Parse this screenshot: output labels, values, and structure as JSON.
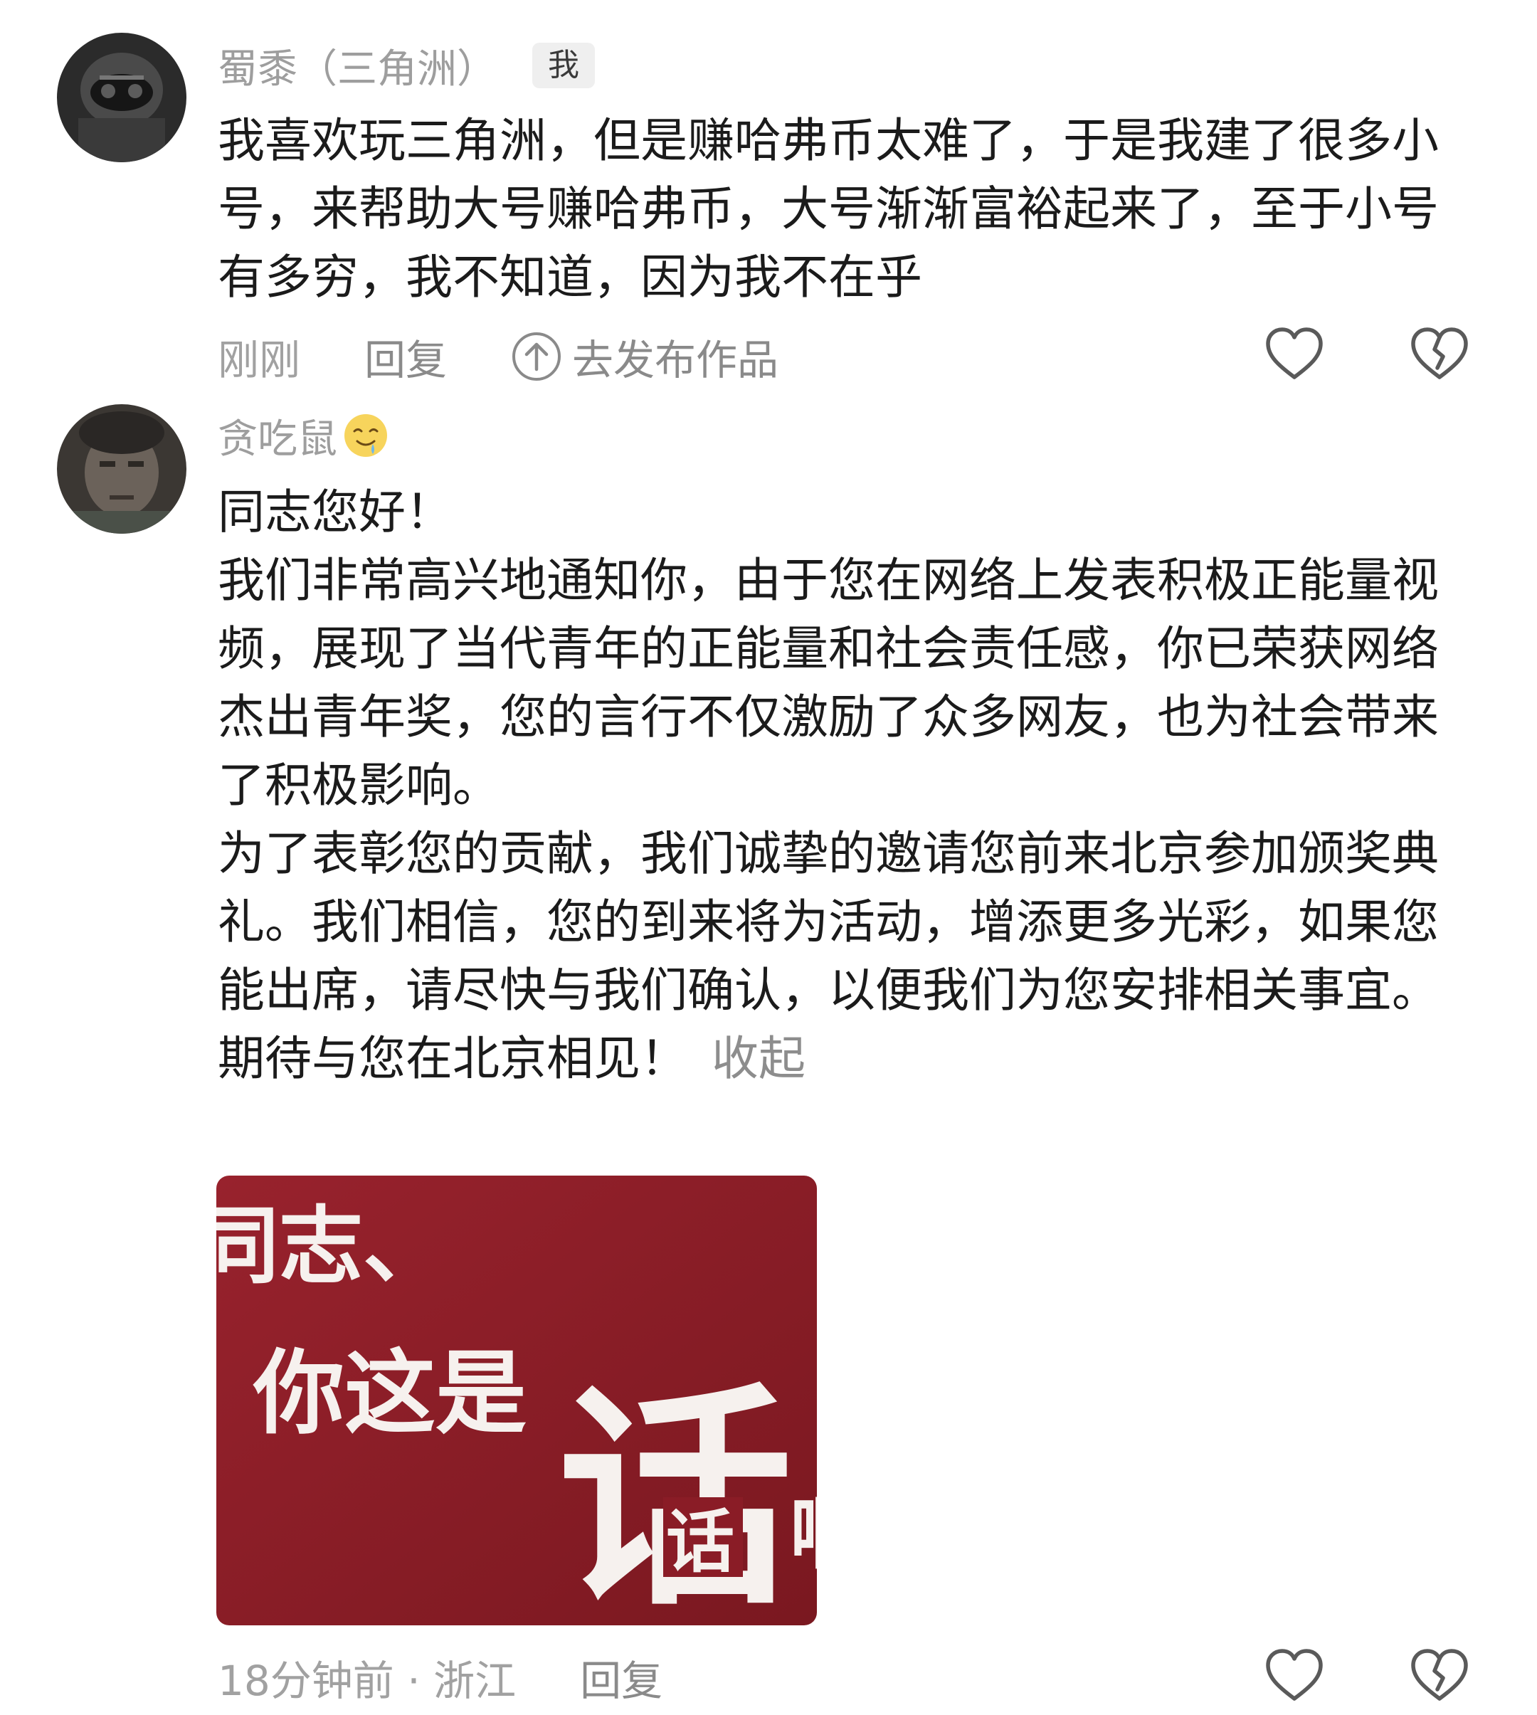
{
  "comments": [
    {
      "username": "蜀黍（三角洲）",
      "badge": "我",
      "text": "我喜欢玩三角洲，但是赚哈弗币太难了，于是我建了很多小号，来帮助大号赚哈弗币，大号渐渐富裕起来了，至于小号有多穷，我不知道，因为我不在乎",
      "time": "刚刚",
      "reply_label": "回复",
      "publish_label": "去发布作品",
      "icons": [
        "up-arrow-circle-icon",
        "heart-icon",
        "broken-heart-icon"
      ]
    },
    {
      "username": "贪吃鼠",
      "emoji": "drooling-face-emoji",
      "paragraphs": [
        "同志您好！",
        "我们非常高兴地通知你，由于您在网络上发表积极正能量视频，展现了当代青年的正能量和社会责任感，你已荣获网络杰出青年奖，您的言行不仅激励了众多网友，也为社会带来了积极影响。",
        "为了表彰您的贡献，我们诚挚的邀请您前来北京参加颁奖典礼。我们相信，您的到来将为活动，增添更多光彩，如果您能出席，请尽快与我们确认，以便我们为您安排相关事宜。",
        "期待与您在北京相见！"
      ],
      "collapse_label": "收起",
      "sticker": {
        "line1": "同志、",
        "line2": "你这是",
        "big_char": "话",
        "small_char": "话",
        "edge_char": "啊",
        "background": "#8a1c26"
      },
      "time": "18分钟前 · 浙江",
      "reply_label": "回复",
      "icons": [
        "heart-icon",
        "broken-heart-icon"
      ]
    }
  ],
  "colors": {
    "text": "#1b1b1b",
    "meta": "#a1a1a1",
    "badge_bg": "#efefef"
  }
}
